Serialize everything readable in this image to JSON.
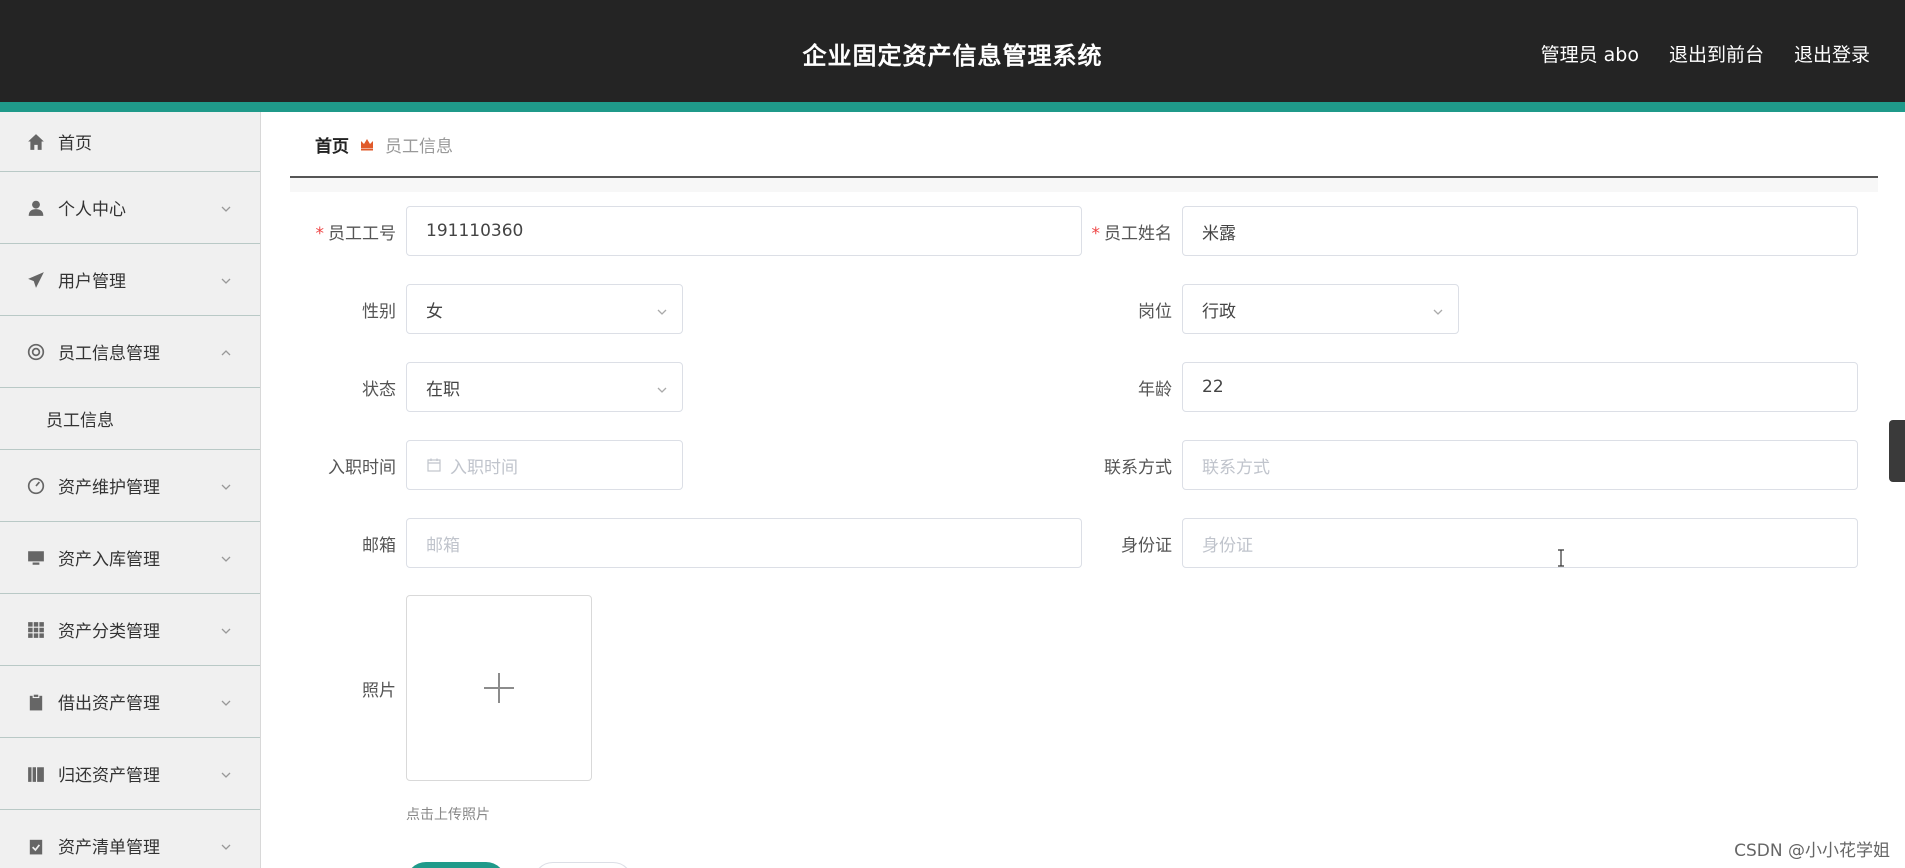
{
  "header": {
    "title": "企业固定资产信息管理系统",
    "admin": "管理员 abo",
    "to_front": "退出到前台",
    "logout": "退出登录"
  },
  "sidebar": {
    "items": [
      {
        "label": "首页",
        "icon": "home-icon"
      },
      {
        "label": "个人中心",
        "icon": "user-icon"
      },
      {
        "label": "用户管理",
        "icon": "send-icon"
      },
      {
        "label": "员工信息管理",
        "icon": "lifebuoy-icon"
      },
      {
        "label": "员工信息",
        "icon": ""
      },
      {
        "label": "资产维护管理",
        "icon": "gauge-icon"
      },
      {
        "label": "资产入库管理",
        "icon": "monitor-icon"
      },
      {
        "label": "资产分类管理",
        "icon": "grid-icon"
      },
      {
        "label": "借出资产管理",
        "icon": "clipboard-icon"
      },
      {
        "label": "归还资产管理",
        "icon": "book-icon"
      },
      {
        "label": "资产清单管理",
        "icon": "checklist-icon"
      }
    ]
  },
  "breadcrumb": {
    "home": "首页",
    "current": "员工信息"
  },
  "form": {
    "emp_no": {
      "label": "员工工号",
      "value": "191110360"
    },
    "emp_name": {
      "label": "员工姓名",
      "value": "米露"
    },
    "gender": {
      "label": "性别",
      "value": "女"
    },
    "position": {
      "label": "岗位",
      "value": "行政"
    },
    "status": {
      "label": "状态",
      "value": "在职"
    },
    "age": {
      "label": "年龄",
      "value": "22"
    },
    "hire_date": {
      "label": "入职时间",
      "placeholder": "入职时间"
    },
    "contact": {
      "label": "联系方式",
      "placeholder": "联系方式"
    },
    "email": {
      "label": "邮箱",
      "placeholder": "邮箱"
    },
    "id_card": {
      "label": "身份证",
      "placeholder": "身份证"
    },
    "photo": {
      "label": "照片",
      "tip": "点击上传照片"
    }
  },
  "watermark": "CSDN @小小花学姐",
  "colors": {
    "header_bg": "#242424",
    "accent": "#1f9a8a",
    "required": "#ee4444"
  }
}
